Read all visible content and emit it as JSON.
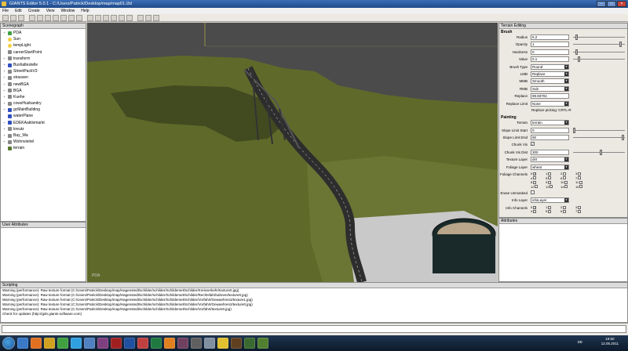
{
  "window": {
    "title": "GIANTS Editor 5.0.1 - C:/Users/Patrick/Desktop/map/map01.i3d",
    "minimize": "–",
    "maximize": "□",
    "close": "×"
  },
  "menu": [
    "File",
    "Edit",
    "Create",
    "View",
    "Window",
    "Help"
  ],
  "scenegraph": {
    "title": "Scenegraph",
    "items": [
      {
        "label": "PDA",
        "icon": "camera-icon",
        "expand": "+"
      },
      {
        "label": "Sun",
        "icon": "light-icon",
        "expand": ""
      },
      {
        "label": "tempLight",
        "icon": "light-icon",
        "expand": ""
      },
      {
        "label": "careerStartPoint",
        "icon": "group-icon",
        "expand": ""
      },
      {
        "label": "transform",
        "icon": "group-icon",
        "expand": "+"
      },
      {
        "label": "Bushaltestelle",
        "icon": "shape-icon",
        "expand": "+"
      },
      {
        "label": "StreetPackV3",
        "icon": "group-icon",
        "expand": "+"
      },
      {
        "label": "strassen",
        "icon": "group-icon",
        "expand": "+"
      },
      {
        "label": "newBGA",
        "icon": "group-icon",
        "expand": "+"
      },
      {
        "label": "BGA",
        "icon": "group-icon",
        "expand": "+"
      },
      {
        "label": "Kuehe",
        "icon": "group-icon",
        "expand": "+"
      },
      {
        "label": "cowsHusbandry",
        "icon": "group-icon",
        "expand": "+"
      },
      {
        "label": "gcMainBuilding",
        "icon": "shape-icon",
        "expand": "+"
      },
      {
        "label": "waterPlane",
        "icon": "shape-icon",
        "expand": ""
      },
      {
        "label": "EDEKAaktivmarkt",
        "icon": "shape-icon",
        "expand": "+"
      },
      {
        "label": "kreutz",
        "icon": "group-icon",
        "expand": "+"
      },
      {
        "label": "Bay_Wa",
        "icon": "group-icon",
        "expand": "+"
      },
      {
        "label": "Wohnviertel",
        "icon": "group-icon",
        "expand": "+"
      },
      {
        "label": "terrain",
        "icon": "terrain-icon",
        "expand": ""
      }
    ]
  },
  "user_attributes": {
    "title": "User Attributes"
  },
  "viewport": {
    "camera_label": "PDA"
  },
  "terrain_editing": {
    "title": "Terrain Editing",
    "brush_section": "Brush",
    "radius": {
      "label": "Radius",
      "value": "5.2",
      "level": 0.05
    },
    "opacity": {
      "label": "Opacity",
      "value": "1",
      "level": 0.95
    },
    "hardness": {
      "label": "Hardness",
      "value": "0",
      "level": 0.05
    },
    "value": {
      "label": "Value",
      "value": "0.1",
      "level": 0.1
    },
    "brush_type": {
      "label": "Brush Type",
      "value": "Round"
    },
    "lmb": {
      "label": "LMB",
      "value": "Replace"
    },
    "mmb": {
      "label": "MMB",
      "value": "Smooth"
    },
    "rmb": {
      "label": "RMB",
      "value": "Sub"
    },
    "replace": {
      "label": "Replace",
      "value": "99.93704"
    },
    "replace_limit": {
      "label": "Replace Limit",
      "value": "None"
    },
    "replace_note": "Replace picking: CRTL-R",
    "painting_section": "Painting",
    "terrain": {
      "label": "Terrain",
      "value": "terrain"
    },
    "slope_start": {
      "label": "Slope Limit Start",
      "value": "0",
      "level": 0.0
    },
    "slope_end": {
      "label": "Slope Limit End",
      "value": "90",
      "level": 1.0
    },
    "chunk_vis": {
      "label": "Chunk Vis",
      "check": "✓"
    },
    "chunk_vis_dist": {
      "label": "Chunk Vis Dist",
      "value": "300",
      "level": 0.55
    },
    "texture_layer": {
      "label": "Texture Layer",
      "value": "dirt"
    },
    "foliage_layer": {
      "label": "Foliage Layer",
      "value": "wheat"
    },
    "foliage_channels": {
      "label": "Foliage Channels",
      "numbers": [
        "0",
        "1",
        "2",
        "3",
        "4",
        "5",
        "6",
        "7",
        "8",
        "9",
        "10",
        "11",
        "12",
        "13",
        "14",
        "15"
      ],
      "checked": [
        true,
        false,
        false,
        false,
        false,
        false,
        false,
        false,
        false,
        false,
        false,
        false,
        false,
        false,
        false,
        false
      ]
    },
    "erase_unmasked": {
      "label": "Erase Unmasked",
      "check": ""
    },
    "info_layer": {
      "label": "Info Layer",
      "value": "infoLayer"
    },
    "info_channels": {
      "label": "Info Channels",
      "numbers": [
        "0",
        "1",
        "2",
        "3",
        "4",
        "5",
        "6",
        "7"
      ],
      "checked": [
        true,
        false,
        false,
        false,
        false,
        false,
        false,
        false
      ]
    }
  },
  "attributes": {
    "title": "Attributes"
  },
  "scripting": {
    "title": "Scripting",
    "lines": [
      "Warning (performance): Raw texture format (C:/Users/Patrick/Desktop/map/Hagenstedt/schilder/schilder/Schilderset/Schilder/Kreisverkehr/texture0.jpg)",
      "Warning (performance): Raw texture format (C:/Users/Patrick/Desktop/map/Hagenstedt/schilder/schilder/Schilderset/Schilder/Rechtsfahrbahnen/texture0.jpg)",
      "Warning (performance): Raw texture format (C:/Users/Patrick/Desktop/map/Hagenstedt/schilder/schilder/Schilderset/Schilder/Vorfahrt/Gewaehren2/texture1.jpg)",
      "Warning (performance): Raw texture format (C:/Users/Patrick/Desktop/map/Hagenstedt/schilder/schilder/Schilderset/Schilder/Vorfahrt/Gewaehren2/texture0.jpg)",
      "Warning (performance): Raw texture format (C:/Users/Patrick/Desktop/map/Hagenstedt/schilder/schilder/Schilderset/Schilder/Vorfahrt/texture0.jpg)",
      "Check for updates (http://gdn.giants-software.com)"
    ]
  },
  "taskbar": {
    "lang": "DE",
    "time": "19:50",
    "date": "12.05.2011"
  },
  "colors": {
    "grass": "#5f6a2a",
    "road": "#3a3a3a",
    "sky": "#4b4b4b"
  }
}
